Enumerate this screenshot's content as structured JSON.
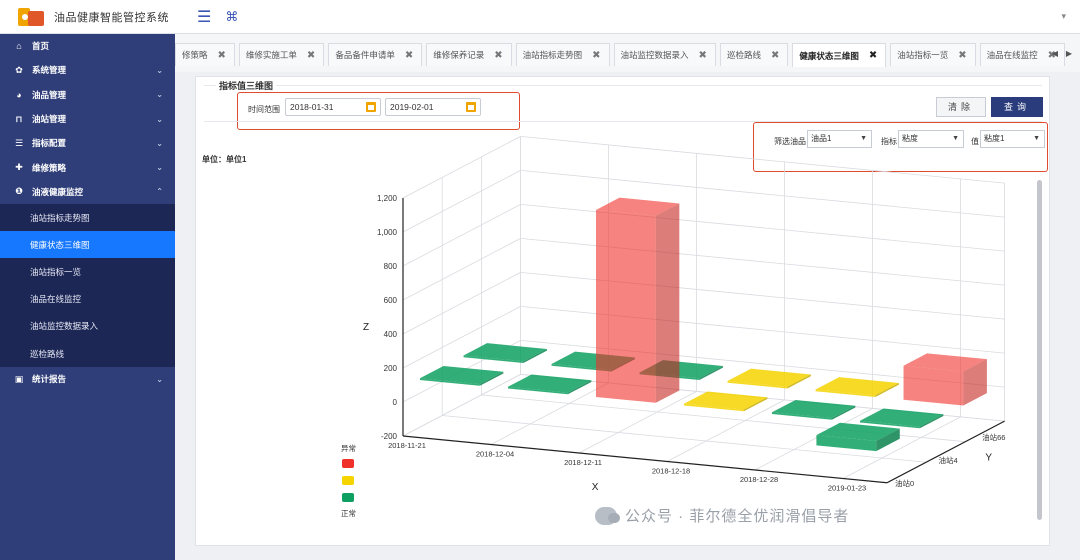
{
  "app": {
    "title": "油品健康智能管控系统"
  },
  "sidebar": {
    "items": [
      {
        "label": "首页",
        "icon": "home-icon",
        "glyph": "⌂",
        "arrow": ""
      },
      {
        "label": "系统管理",
        "icon": "gear-icon",
        "glyph": "✿",
        "arrow": "⌄"
      },
      {
        "label": "油品管理",
        "icon": "drop-icon",
        "glyph": "◕",
        "arrow": "⌄"
      },
      {
        "label": "油站管理",
        "icon": "station-icon",
        "glyph": "⊓",
        "arrow": "⌄"
      },
      {
        "label": "指标配置",
        "icon": "sliders-icon",
        "glyph": "☰",
        "arrow": "⌄"
      },
      {
        "label": "维修策略",
        "icon": "tool-icon",
        "glyph": "✚",
        "arrow": "⌄"
      },
      {
        "label": "油液健康监控",
        "icon": "monitor-icon",
        "glyph": "❶",
        "arrow": "⌃"
      }
    ],
    "subitems": [
      {
        "label": "油站指标走势图",
        "active": false
      },
      {
        "label": "健康状态三维图",
        "active": true
      },
      {
        "label": "油站指标一览",
        "active": false
      },
      {
        "label": "油品在线监控",
        "active": false
      },
      {
        "label": "油站监控数据录入",
        "active": false
      },
      {
        "label": "巡检路线",
        "active": false
      }
    ],
    "report": {
      "label": "统计报告",
      "icon": "report-icon",
      "glyph": "▣",
      "arrow": "⌄"
    }
  },
  "tabs": [
    {
      "label": "修策略",
      "active": false
    },
    {
      "label": "维修实施工单",
      "active": false
    },
    {
      "label": "备品备件申请单",
      "active": false
    },
    {
      "label": "维修保养记录",
      "active": false
    },
    {
      "label": "油站指标走势图",
      "active": false
    },
    {
      "label": "油站监控数据录入",
      "active": false
    },
    {
      "label": "巡检路线",
      "active": false
    },
    {
      "label": "健康状态三维图",
      "active": true
    },
    {
      "label": "油站指标一览",
      "active": false
    },
    {
      "label": "油品在线监控",
      "active": false
    }
  ],
  "panel": {
    "title": "指标值三维图",
    "time_range_label": "时间范围",
    "start_date": "2018-01-31",
    "end_date": "2019-02-01",
    "clear_label": "清除",
    "query_label": "查询",
    "filter_oil_label": "筛选油品",
    "filter_oil_value": "油品1",
    "indicator_label": "指标",
    "indicator_value": "粘度",
    "value_label": "值",
    "value_value": "粘度1",
    "unit_label": "单位：单位1"
  },
  "chart_data": {
    "type": "bar3d",
    "x_label": "X",
    "y_label": "Y",
    "z_label": "Z",
    "x_ticks": [
      "2018-11-21",
      "2018-12-04",
      "2018-12-11",
      "2018-12-18",
      "2018-12-28",
      "2019-01-23"
    ],
    "y_ticks": [
      "油站0",
      "油站4",
      "油站66"
    ],
    "z_ticks": [
      -200,
      0,
      200,
      400,
      600,
      800,
      1000,
      1200
    ],
    "zlim": [
      -200,
      1200
    ],
    "legend": {
      "top": "异常",
      "bottom": "正常",
      "colors": [
        "#f0302a",
        "#f5d400",
        "#0ea060"
      ]
    },
    "bars": [
      {
        "x": "2018-11-21",
        "y": "油站66",
        "value": 10,
        "status": "normal"
      },
      {
        "x": "2018-12-04",
        "y": "油站66",
        "value": 10,
        "status": "normal"
      },
      {
        "x": "2018-12-11",
        "y": "油站66",
        "value": 10,
        "status": "normal"
      },
      {
        "x": "2018-12-18",
        "y": "油站66",
        "value": 10,
        "status": "warning"
      },
      {
        "x": "2018-12-28",
        "y": "油站66",
        "value": 10,
        "status": "warning"
      },
      {
        "x": "2019-01-23",
        "y": "油站66",
        "value": 200,
        "status": "abnormal"
      },
      {
        "x": "2018-11-21",
        "y": "油站4",
        "value": 10,
        "status": "normal"
      },
      {
        "x": "2018-12-04",
        "y": "油站4",
        "value": 10,
        "status": "normal"
      },
      {
        "x": "2018-12-11",
        "y": "油站4",
        "value": 1100,
        "status": "abnormal"
      },
      {
        "x": "2018-12-18",
        "y": "油站4",
        "value": 10,
        "status": "warning"
      },
      {
        "x": "2018-12-28",
        "y": "油站4",
        "value": 10,
        "status": "normal"
      },
      {
        "x": "2019-01-23",
        "y": "油站4",
        "value": 10,
        "status": "normal"
      },
      {
        "x": "2019-01-23",
        "y": "油站0",
        "value": 60,
        "status": "normal"
      }
    ]
  },
  "watermark": {
    "text": "公众号 · 菲尔德全优润滑倡导者"
  }
}
